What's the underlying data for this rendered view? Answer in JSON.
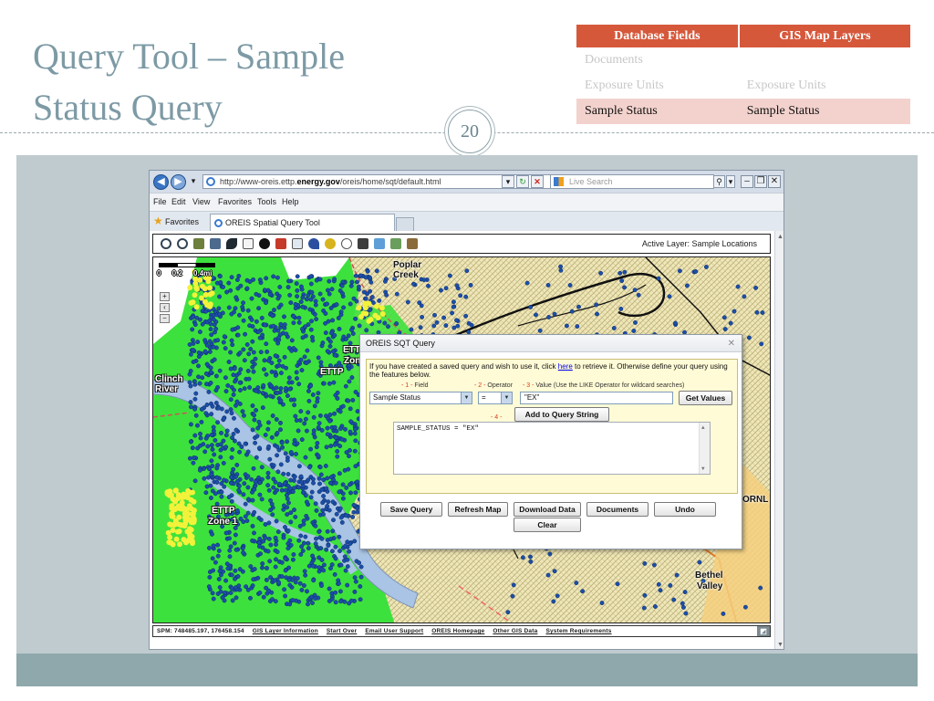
{
  "slide": {
    "title_line1": "Query Tool – Sample",
    "title_line2": "Status Query",
    "page_number": "20",
    "table": {
      "headers": [
        "Database Fields",
        "GIS Map Layers"
      ],
      "rows": [
        [
          "Documents",
          ""
        ],
        [
          "Exposure Units",
          "Exposure Units"
        ],
        [
          "Sample Status",
          "Sample Status"
        ]
      ]
    }
  },
  "browser": {
    "url_prefix": "http://www-oreis.ettp.",
    "url_domain": "energy.gov",
    "url_suffix": "/oreis/home/sqt/default.html",
    "search_placeholder": "Live Search",
    "menu": [
      "File",
      "Edit",
      "View",
      "Favorites",
      "Tools",
      "Help"
    ],
    "favorites_label": "Favorites",
    "tab_title": "OREIS Spatial Query Tool"
  },
  "map_app": {
    "active_layer": "Active Layer: Sample Locations",
    "scale_labels": "0 0.2 0.4mi",
    "labels": {
      "poplar": "Poplar",
      "creek": "Creek",
      "clinch": "Clinch",
      "river": "River",
      "ettp_a": "ETTP",
      "zone_a": "Zone",
      "ettp_b": "ETTP",
      "zone_b": "Zone 1",
      "ornl": "ORNL",
      "bethel": "Bethel",
      "valley": "Valley",
      "ettp_c": "ETTP"
    },
    "status": {
      "coords": "SPM: 748485.197, 176458.154",
      "links": [
        "GIS Layer Information",
        "Start Over",
        "Email User Support",
        "OREIS Homepage",
        "Other GIS Data",
        "System Requirements"
      ]
    }
  },
  "dialog": {
    "title": "OREIS SQT Query",
    "intro_before": "If you have created a saved query and wish to use it, click ",
    "intro_link": "here",
    "intro_after": " to retrieve it. Otherwise define your query using the features below.",
    "step1": "- 1 -",
    "step1_label": "Field",
    "step2": "- 2 -",
    "step2_label": "Operator",
    "step3": "- 3 -",
    "step3_label": "Value (Use the LIKE Operator for wildcard searches)",
    "step4": "- 4 -",
    "field_value": "Sample Status",
    "operator_value": "=",
    "value_text": "\"EX\"",
    "get_values": "Get Values",
    "add_to_query": "Add to Query String",
    "query_string": "SAMPLE_STATUS = \"EX\"",
    "buttons": {
      "save": "Save Query",
      "refresh": "Refresh Map",
      "download": "Download Data",
      "documents": "Documents",
      "undo": "Undo",
      "clear": "Clear"
    }
  },
  "colors": {
    "title": "#7d9aa5",
    "table_header": "#d6583b",
    "table_highlight": "#f3d2cd",
    "map_green": "#3de13d",
    "map_points": "#1c4fa8",
    "map_yellow": "#f2f23a",
    "map_hatch": "#efe7b8"
  }
}
